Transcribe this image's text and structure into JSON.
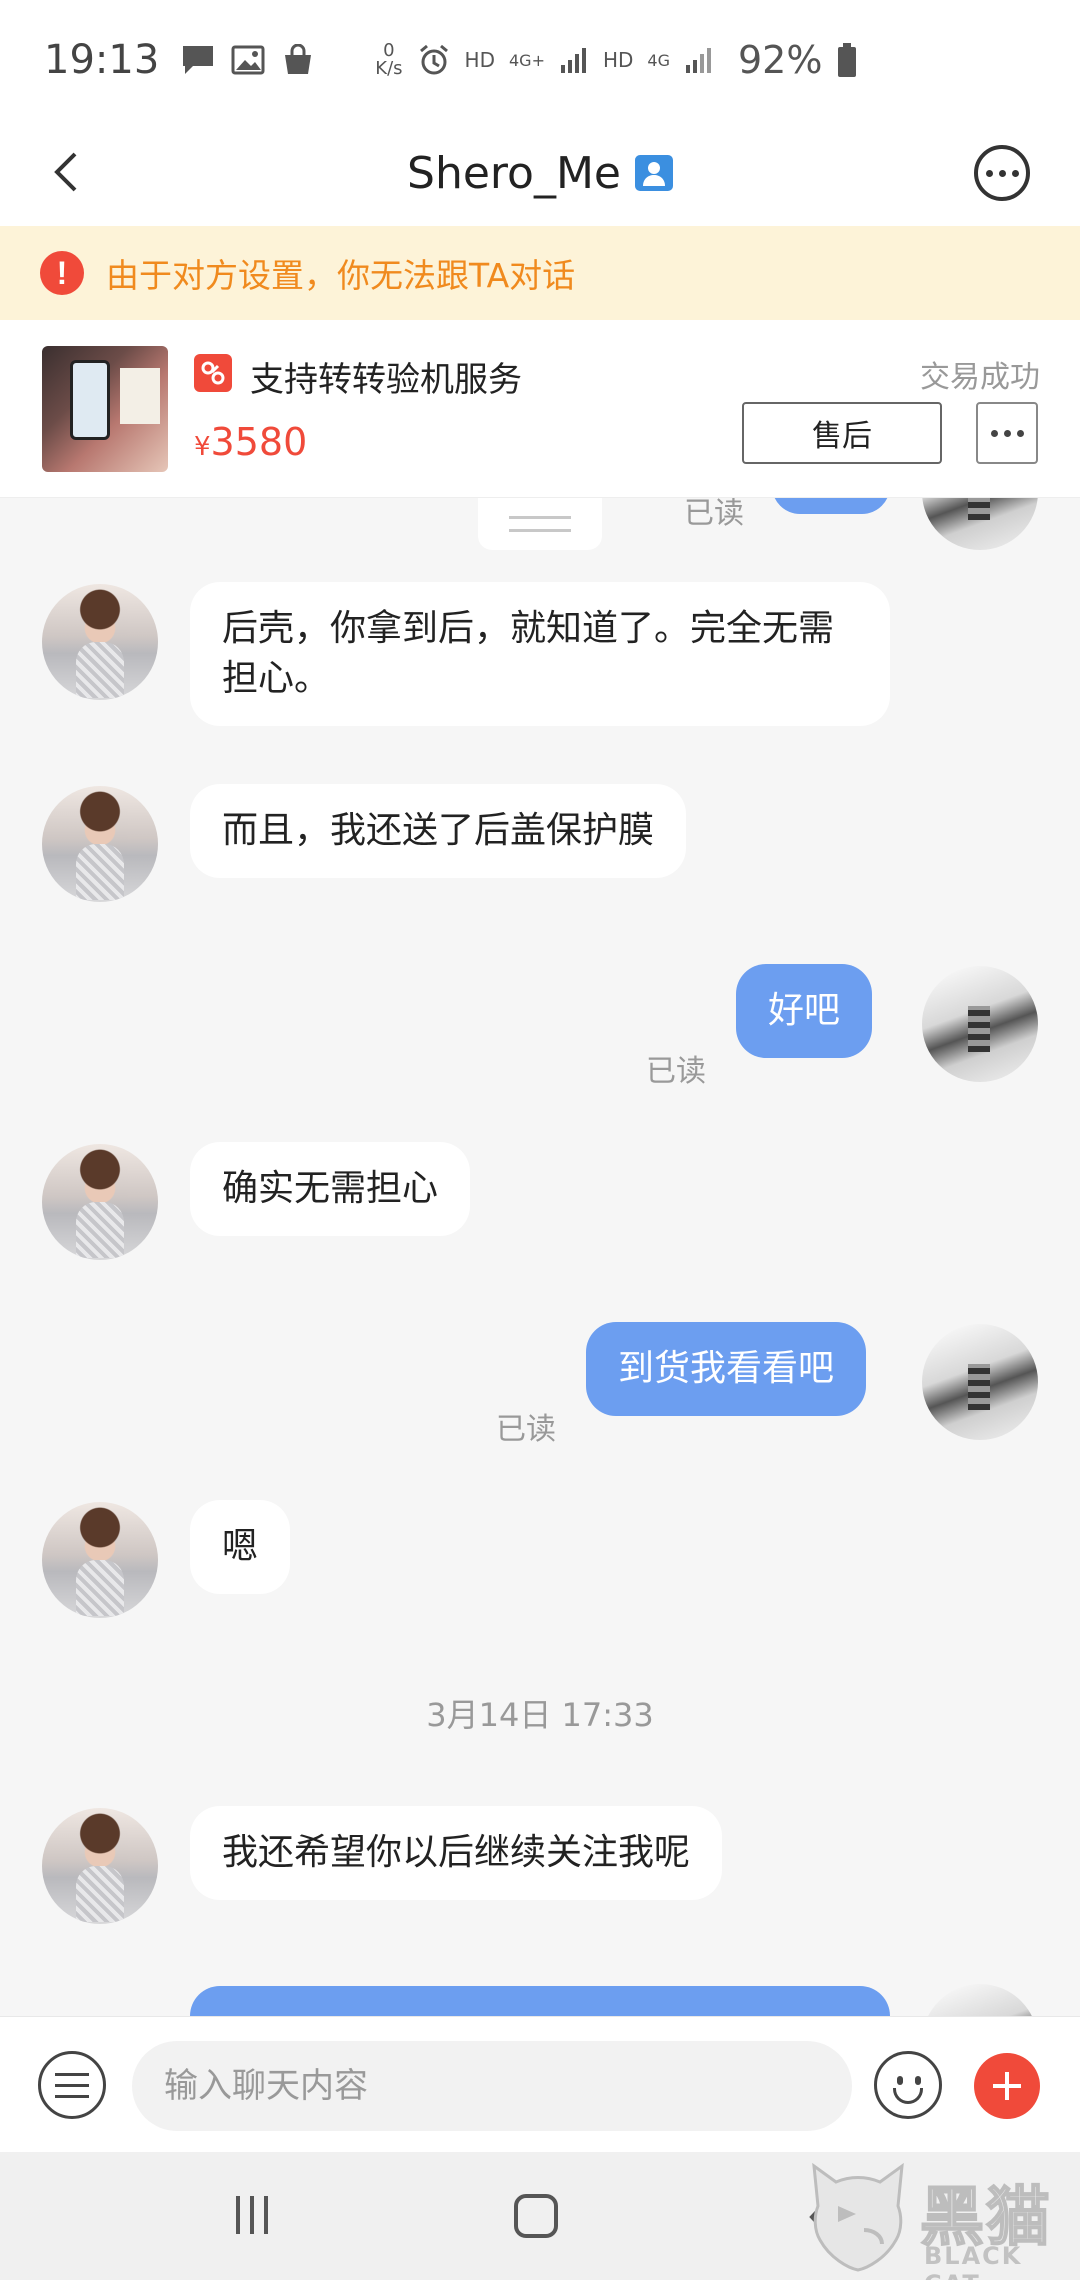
{
  "status_bar": {
    "time": "19:13",
    "net_speed_value": "0",
    "net_speed_unit": "K/s",
    "hd_1": "HD",
    "net_1": "4G+",
    "hd_2": "HD",
    "net_2": "4G",
    "battery": "92%"
  },
  "header": {
    "title": "Shero_Me"
  },
  "warning": {
    "text": "由于对方设置，你无法跟TA对话"
  },
  "product": {
    "service_label": "支持转转验机服务",
    "currency": "¥",
    "price": "3580",
    "status": "交易成功",
    "after_sale_label": "售后"
  },
  "chat": {
    "top_read": "已读",
    "messages": [
      {
        "side": "left",
        "text": "后壳，你拿到后，就知道了。完全无需担心。"
      },
      {
        "side": "left",
        "text": "而且，我还送了后盖保护膜"
      },
      {
        "side": "right",
        "text": "好吧",
        "status": "已读"
      },
      {
        "side": "left",
        "text": "确实无需担心"
      },
      {
        "side": "right",
        "text": "到货我看看吧",
        "status": "已读"
      },
      {
        "side": "left",
        "text": "嗯"
      },
      {
        "side": "left",
        "text": "我还希望你以后继续关注我呢"
      }
    ],
    "timestamp": "3月14日 17:33"
  },
  "input_bar": {
    "placeholder": "输入聊天内容"
  },
  "watermark": {
    "cn": "黑猫",
    "en": "BLACK CAT"
  },
  "colors": {
    "accent_red": "#f04a3a",
    "bubble_blue": "#6c9ef0",
    "warning_bg": "#fdf3d8",
    "warning_text": "#f08a1e"
  }
}
